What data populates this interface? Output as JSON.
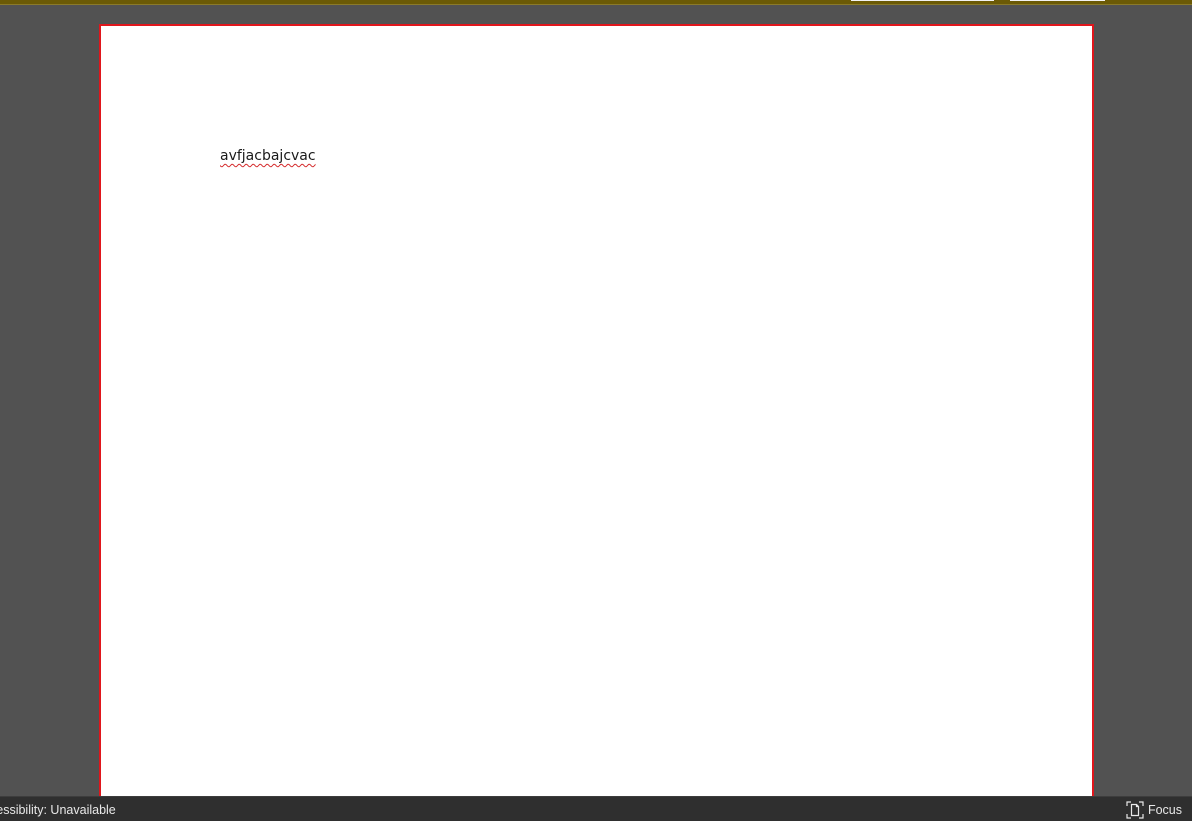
{
  "document": {
    "text": "avfjacbajcvac"
  },
  "status_bar": {
    "accessibility": "cessibility: Unavailable",
    "focus_label": "Focus",
    "focus_icon": "focus-mode-icon"
  },
  "colors": {
    "ribbon_strip": "#6b5a06",
    "canvas_bg": "#525252",
    "page_border": "#e0161c",
    "status_bar_bg": "#2f2f2f"
  }
}
